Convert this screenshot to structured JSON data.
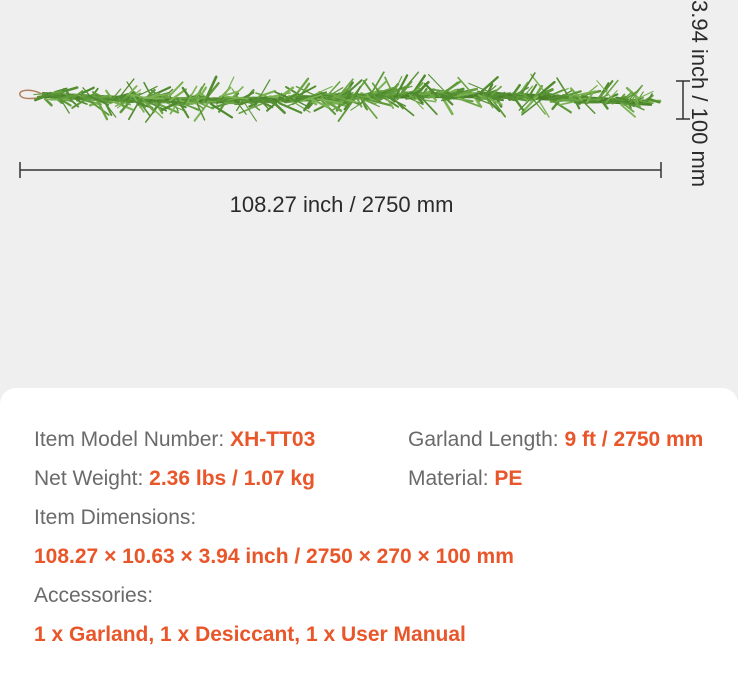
{
  "dimensions": {
    "length_label": "108.27 inch / 2750 mm",
    "height_label": "3.94 inch / 100 mm"
  },
  "specs": {
    "model": {
      "label": "Item Model Number:",
      "value": "XH-TT03"
    },
    "garland_length": {
      "label": "Garland Length:",
      "value": "9 ft / 2750 mm"
    },
    "net_weight": {
      "label": "Net Weight:",
      "value": "2.36 lbs / 1.07 kg"
    },
    "material": {
      "label": "Material:",
      "value": "PE"
    },
    "item_dimensions": {
      "label": "Item Dimensions:",
      "value": "108.27 × 10.63 × 3.94 inch / 2750 × 270 × 100 mm"
    },
    "accessories": {
      "label": "Accessories:",
      "value": "1 x Garland, 1 x Desiccant, 1 x User Manual"
    }
  },
  "colors": {
    "accent": "#e8562a",
    "garland_green": "#5f9a3a",
    "background": "#efefef",
    "card": "#ffffff"
  }
}
